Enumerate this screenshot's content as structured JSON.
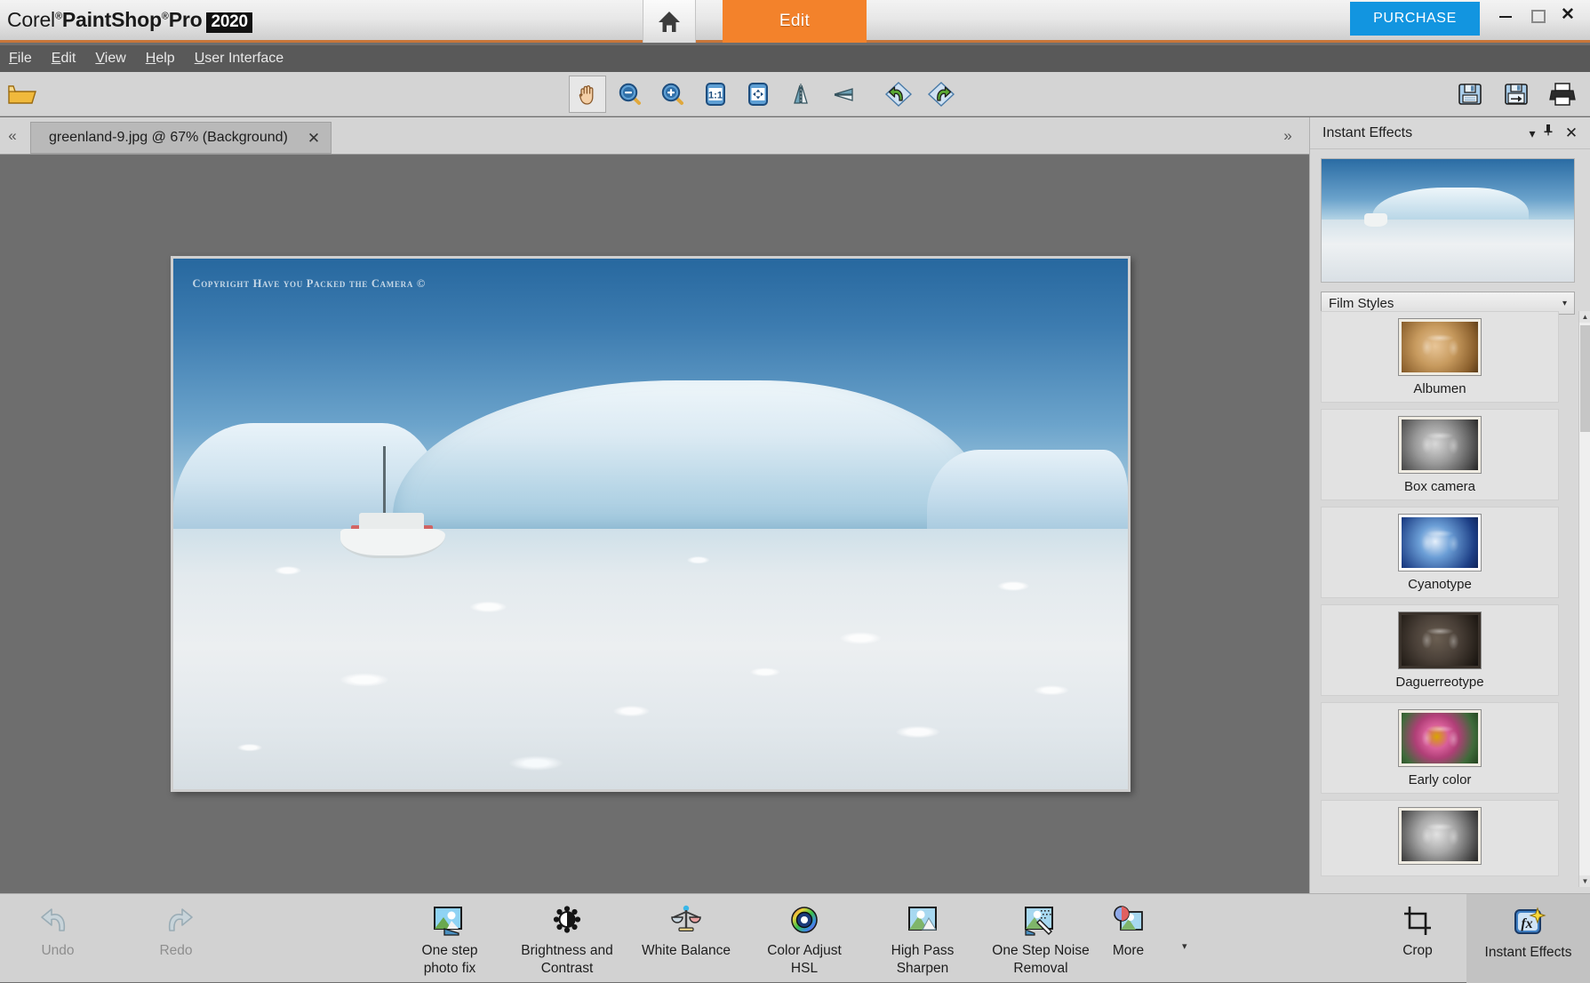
{
  "app": {
    "brand_corel": "Corel",
    "brand_paintshop": "PaintShop",
    "brand_pro": "Pro",
    "brand_year": "2020",
    "reg_mark": "®"
  },
  "titlebar": {
    "home_tab_label": "Home",
    "edit_tab_label": "Edit",
    "purchase_label": "PURCHASE",
    "window_controls": {
      "minimize": "minimize-icon",
      "maximize": "maximize-icon",
      "close": "✕"
    },
    "accent_orange": "#f3822b",
    "accent_blue": "#1295e0",
    "border_orange": "#c8763a"
  },
  "menubar": {
    "items": [
      {
        "label": "File",
        "mnemonic": "F"
      },
      {
        "label": "Edit",
        "mnemonic": "E"
      },
      {
        "label": "View",
        "mnemonic": "V"
      },
      {
        "label": "Help",
        "mnemonic": "H"
      },
      {
        "label": "User Interface",
        "mnemonic": "U"
      }
    ]
  },
  "toolbar": {
    "open_label": "Open",
    "tools": [
      {
        "name": "pan-tool",
        "label": "Pan",
        "active": true
      },
      {
        "name": "zoom-out-tool",
        "label": "Zoom Out",
        "active": false
      },
      {
        "name": "zoom-in-tool",
        "label": "Zoom In",
        "active": false
      },
      {
        "name": "actual-size-tool",
        "label": "1:1",
        "active": false
      },
      {
        "name": "fit-to-window-tool",
        "label": "Fit to Window",
        "active": false
      },
      {
        "name": "mirror-tool",
        "label": "Mirror",
        "active": false
      },
      {
        "name": "flip-tool",
        "label": "Flip",
        "active": false
      },
      {
        "name": "undo-tool",
        "label": "Undo",
        "active": false
      },
      {
        "name": "redo-tool",
        "label": "Redo",
        "active": false
      }
    ],
    "right_tools": [
      {
        "name": "save-icon",
        "label": "Save"
      },
      {
        "name": "save-as-icon",
        "label": "Save As"
      },
      {
        "name": "print-icon",
        "label": "Print"
      }
    ]
  },
  "tabbar": {
    "scroll_left": "«",
    "scroll_right": "»",
    "document": {
      "filename": "greenland-9.jpg",
      "separator": "@",
      "zoom": "67%",
      "layer": "(Background)",
      "full_label": "greenland-9.jpg @  67% (Background)",
      "close_glyph": "✕"
    }
  },
  "canvas": {
    "watermark": "Copyright Have you Packed the Camera ©",
    "image_description": "Iceberg and boat in Greenland"
  },
  "instant_effects": {
    "panel_title": "Instant Effects",
    "menu_caret": "▾",
    "pin_glyph": "⍗",
    "close_glyph": "✕",
    "category_selected": "Film Styles",
    "category_caret": "▾",
    "effects": [
      {
        "label": "Albumen",
        "thumb_class": "th-albumen"
      },
      {
        "label": "Box camera",
        "thumb_class": "th-box"
      },
      {
        "label": "Cyanotype",
        "thumb_class": "th-cyan"
      },
      {
        "label": "Daguerreotype",
        "thumb_class": "th-dag"
      },
      {
        "label": "Early color",
        "thumb_class": "th-early"
      },
      {
        "label": "",
        "thumb_class": "th-partial"
      }
    ],
    "scroll_up": "▲",
    "scroll_down": "▼"
  },
  "bottombar": {
    "undo_label": "Undo",
    "redo_label": "Redo",
    "tools": [
      {
        "label": "One step\nphoto fix",
        "name": "one-step-photo-fix",
        "line1": "One step",
        "line2": "photo fix"
      },
      {
        "label": "Brightness and Contrast",
        "name": "brightness-and-contrast",
        "line1": "Brightness and",
        "line2": "Contrast"
      },
      {
        "label": "White Balance",
        "name": "white-balance",
        "line1": "White Balance",
        "line2": ""
      },
      {
        "label": "Color Adjust HSL",
        "name": "color-adjust-hsl",
        "line1": "Color Adjust",
        "line2": "HSL"
      },
      {
        "label": "High Pass Sharpen",
        "name": "high-pass-sharpen",
        "line1": "High Pass",
        "line2": "Sharpen"
      },
      {
        "label": "One Step Noise Removal",
        "name": "one-step-noise-removal",
        "line1": "One Step Noise",
        "line2": "Removal"
      },
      {
        "label": "More",
        "name": "more",
        "line1": "More",
        "line2": ""
      }
    ],
    "more_caret": "▾",
    "crop_label": "Crop",
    "instant_effects_label": "Instant Effects"
  }
}
